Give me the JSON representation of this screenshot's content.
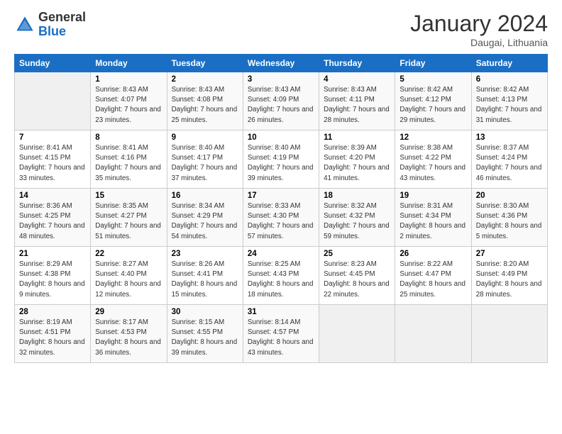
{
  "header": {
    "logo_general": "General",
    "logo_blue": "Blue",
    "month_year": "January 2024",
    "location": "Daugai, Lithuania"
  },
  "weekdays": [
    "Sunday",
    "Monday",
    "Tuesday",
    "Wednesday",
    "Thursday",
    "Friday",
    "Saturday"
  ],
  "weeks": [
    [
      {
        "day": "",
        "empty": true
      },
      {
        "day": "1",
        "sunrise": "Sunrise: 8:43 AM",
        "sunset": "Sunset: 4:07 PM",
        "daylight": "Daylight: 7 hours and 23 minutes."
      },
      {
        "day": "2",
        "sunrise": "Sunrise: 8:43 AM",
        "sunset": "Sunset: 4:08 PM",
        "daylight": "Daylight: 7 hours and 25 minutes."
      },
      {
        "day": "3",
        "sunrise": "Sunrise: 8:43 AM",
        "sunset": "Sunset: 4:09 PM",
        "daylight": "Daylight: 7 hours and 26 minutes."
      },
      {
        "day": "4",
        "sunrise": "Sunrise: 8:43 AM",
        "sunset": "Sunset: 4:11 PM",
        "daylight": "Daylight: 7 hours and 28 minutes."
      },
      {
        "day": "5",
        "sunrise": "Sunrise: 8:42 AM",
        "sunset": "Sunset: 4:12 PM",
        "daylight": "Daylight: 7 hours and 29 minutes."
      },
      {
        "day": "6",
        "sunrise": "Sunrise: 8:42 AM",
        "sunset": "Sunset: 4:13 PM",
        "daylight": "Daylight: 7 hours and 31 minutes."
      }
    ],
    [
      {
        "day": "7",
        "sunrise": "Sunrise: 8:41 AM",
        "sunset": "Sunset: 4:15 PM",
        "daylight": "Daylight: 7 hours and 33 minutes."
      },
      {
        "day": "8",
        "sunrise": "Sunrise: 8:41 AM",
        "sunset": "Sunset: 4:16 PM",
        "daylight": "Daylight: 7 hours and 35 minutes."
      },
      {
        "day": "9",
        "sunrise": "Sunrise: 8:40 AM",
        "sunset": "Sunset: 4:17 PM",
        "daylight": "Daylight: 7 hours and 37 minutes."
      },
      {
        "day": "10",
        "sunrise": "Sunrise: 8:40 AM",
        "sunset": "Sunset: 4:19 PM",
        "daylight": "Daylight: 7 hours and 39 minutes."
      },
      {
        "day": "11",
        "sunrise": "Sunrise: 8:39 AM",
        "sunset": "Sunset: 4:20 PM",
        "daylight": "Daylight: 7 hours and 41 minutes."
      },
      {
        "day": "12",
        "sunrise": "Sunrise: 8:38 AM",
        "sunset": "Sunset: 4:22 PM",
        "daylight": "Daylight: 7 hours and 43 minutes."
      },
      {
        "day": "13",
        "sunrise": "Sunrise: 8:37 AM",
        "sunset": "Sunset: 4:24 PM",
        "daylight": "Daylight: 7 hours and 46 minutes."
      }
    ],
    [
      {
        "day": "14",
        "sunrise": "Sunrise: 8:36 AM",
        "sunset": "Sunset: 4:25 PM",
        "daylight": "Daylight: 7 hours and 48 minutes."
      },
      {
        "day": "15",
        "sunrise": "Sunrise: 8:35 AM",
        "sunset": "Sunset: 4:27 PM",
        "daylight": "Daylight: 7 hours and 51 minutes."
      },
      {
        "day": "16",
        "sunrise": "Sunrise: 8:34 AM",
        "sunset": "Sunset: 4:29 PM",
        "daylight": "Daylight: 7 hours and 54 minutes."
      },
      {
        "day": "17",
        "sunrise": "Sunrise: 8:33 AM",
        "sunset": "Sunset: 4:30 PM",
        "daylight": "Daylight: 7 hours and 57 minutes."
      },
      {
        "day": "18",
        "sunrise": "Sunrise: 8:32 AM",
        "sunset": "Sunset: 4:32 PM",
        "daylight": "Daylight: 7 hours and 59 minutes."
      },
      {
        "day": "19",
        "sunrise": "Sunrise: 8:31 AM",
        "sunset": "Sunset: 4:34 PM",
        "daylight": "Daylight: 8 hours and 2 minutes."
      },
      {
        "day": "20",
        "sunrise": "Sunrise: 8:30 AM",
        "sunset": "Sunset: 4:36 PM",
        "daylight": "Daylight: 8 hours and 5 minutes."
      }
    ],
    [
      {
        "day": "21",
        "sunrise": "Sunrise: 8:29 AM",
        "sunset": "Sunset: 4:38 PM",
        "daylight": "Daylight: 8 hours and 9 minutes."
      },
      {
        "day": "22",
        "sunrise": "Sunrise: 8:27 AM",
        "sunset": "Sunset: 4:40 PM",
        "daylight": "Daylight: 8 hours and 12 minutes."
      },
      {
        "day": "23",
        "sunrise": "Sunrise: 8:26 AM",
        "sunset": "Sunset: 4:41 PM",
        "daylight": "Daylight: 8 hours and 15 minutes."
      },
      {
        "day": "24",
        "sunrise": "Sunrise: 8:25 AM",
        "sunset": "Sunset: 4:43 PM",
        "daylight": "Daylight: 8 hours and 18 minutes."
      },
      {
        "day": "25",
        "sunrise": "Sunrise: 8:23 AM",
        "sunset": "Sunset: 4:45 PM",
        "daylight": "Daylight: 8 hours and 22 minutes."
      },
      {
        "day": "26",
        "sunrise": "Sunrise: 8:22 AM",
        "sunset": "Sunset: 4:47 PM",
        "daylight": "Daylight: 8 hours and 25 minutes."
      },
      {
        "day": "27",
        "sunrise": "Sunrise: 8:20 AM",
        "sunset": "Sunset: 4:49 PM",
        "daylight": "Daylight: 8 hours and 28 minutes."
      }
    ],
    [
      {
        "day": "28",
        "sunrise": "Sunrise: 8:19 AM",
        "sunset": "Sunset: 4:51 PM",
        "daylight": "Daylight: 8 hours and 32 minutes."
      },
      {
        "day": "29",
        "sunrise": "Sunrise: 8:17 AM",
        "sunset": "Sunset: 4:53 PM",
        "daylight": "Daylight: 8 hours and 36 minutes."
      },
      {
        "day": "30",
        "sunrise": "Sunrise: 8:15 AM",
        "sunset": "Sunset: 4:55 PM",
        "daylight": "Daylight: 8 hours and 39 minutes."
      },
      {
        "day": "31",
        "sunrise": "Sunrise: 8:14 AM",
        "sunset": "Sunset: 4:57 PM",
        "daylight": "Daylight: 8 hours and 43 minutes."
      },
      {
        "day": "",
        "empty": true
      },
      {
        "day": "",
        "empty": true
      },
      {
        "day": "",
        "empty": true
      }
    ]
  ]
}
